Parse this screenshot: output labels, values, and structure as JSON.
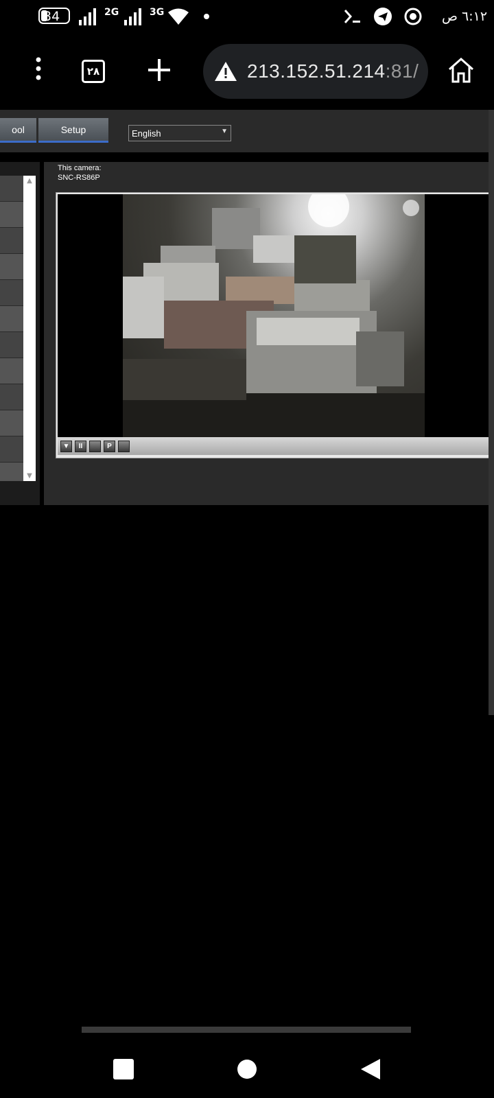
{
  "status_bar": {
    "battery": "34",
    "net_2g": "2G",
    "net_3g": "3G",
    "time": "٦:١٢ ص"
  },
  "browser": {
    "tab_count": "٢٨",
    "url_host": "213.152.51.214",
    "url_rest": ":81/"
  },
  "page": {
    "menu": [
      {
        "label": "ool"
      },
      {
        "label": "Setup"
      }
    ],
    "language": "English",
    "camera_caption": "This camera:",
    "camera_model": "SNC-RS86P",
    "controls": [
      "▼",
      "II",
      "",
      "P",
      ""
    ]
  }
}
